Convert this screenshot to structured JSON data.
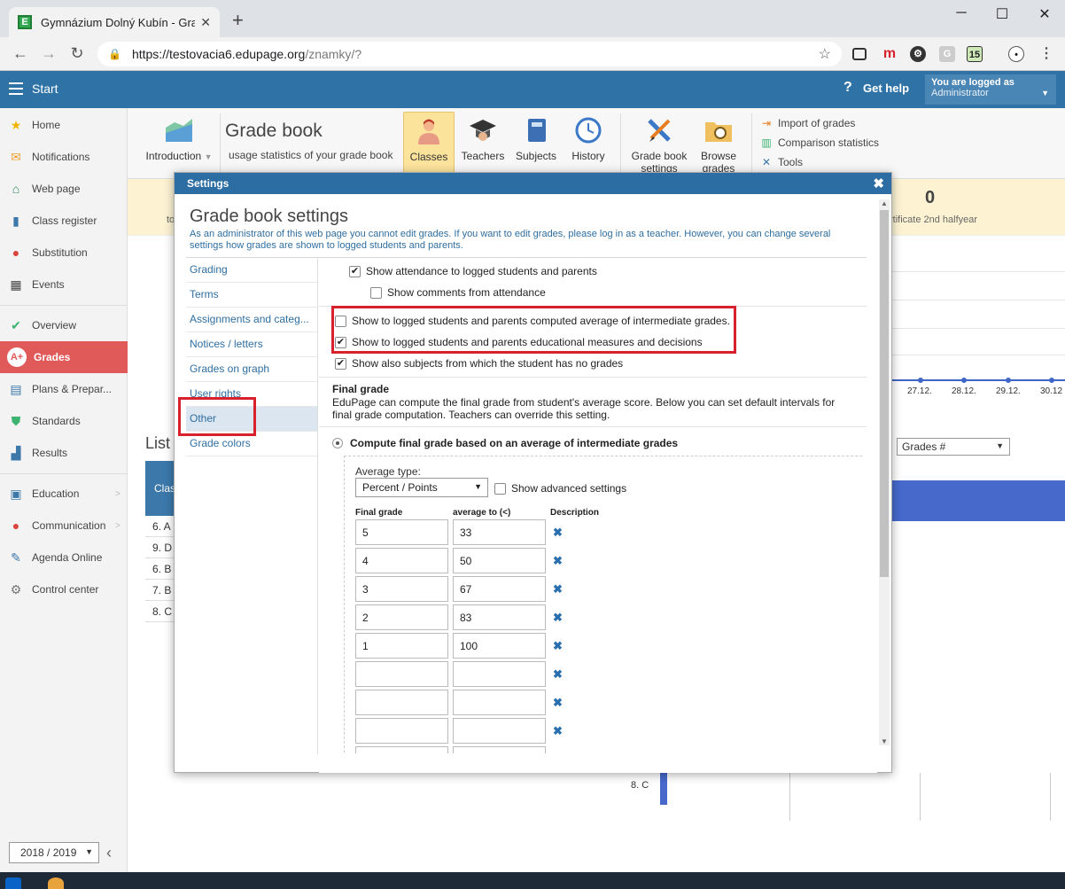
{
  "browser": {
    "tab_title": "Gymnázium Dolný Kubín - Grade",
    "url_host": "https://testovacia6.edupage.org",
    "url_path": "/znamky/?",
    "extensions": [
      "m",
      "G",
      "15"
    ]
  },
  "header": {
    "start": "Start",
    "help": "Get help",
    "logged_as": "You are logged as",
    "user": "Administrator"
  },
  "sidebar": {
    "items": [
      {
        "label": "Home",
        "icon": "star-icon"
      },
      {
        "label": "Notifications",
        "icon": "envelope-icon"
      },
      {
        "label": "Web page",
        "icon": "house-icon"
      },
      {
        "label": "Class register",
        "icon": "book-icon"
      },
      {
        "label": "Substitution",
        "icon": "person-icon"
      },
      {
        "label": "Events",
        "icon": "calendar-icon"
      },
      {
        "label": "Overview",
        "icon": "check-icon"
      },
      {
        "label": "Grades",
        "icon": "grade-icon"
      },
      {
        "label": "Plans & Prepar...",
        "icon": "briefcase-icon"
      },
      {
        "label": "Standards",
        "icon": "shield-icon"
      },
      {
        "label": "Results",
        "icon": "barchart-icon"
      },
      {
        "label": "Education",
        "icon": "education-icon"
      },
      {
        "label": "Communication",
        "icon": "chat-icon"
      },
      {
        "label": "Agenda Online",
        "icon": "pen-icon"
      },
      {
        "label": "Control center",
        "icon": "gear-icon"
      }
    ],
    "year": "2018 / 2019"
  },
  "ribbon": {
    "introduction": "Introduction",
    "title": "Grade book",
    "subtitle": "usage statistics of your grade book",
    "classes": "Classes",
    "teachers": "Teachers",
    "subjects": "Subjects",
    "history": "History",
    "settings_l1": "Grade book",
    "settings_l2": "settings",
    "browse_l1": "Browse",
    "browse_l2": "grades",
    "import": "Import of grades",
    "comparison": "Comparison statistics",
    "tools": "Tools"
  },
  "background": {
    "stat_value": "0",
    "stat_label": "rtificate 2nd halfyear",
    "stat_left": "to",
    "dates": [
      "27.12.",
      "28.12.",
      "29.12.",
      "30.12"
    ],
    "list_title": "List",
    "grades_select": "Grades #",
    "class_head": "Clas",
    "class_rows": [
      "6. A",
      "9. D",
      "6. B",
      "7. B",
      "8. C"
    ],
    "bar_label": "8. C"
  },
  "dialog": {
    "header": "Settings",
    "title": "Grade book settings",
    "description": "As an administrator of this web page you cannot edit grades. If you want to edit grades, please log in as a teacher. However, you can change several settings how grades are shown to logged students and parents.",
    "nav": [
      "Grading",
      "Terms",
      "Assignments and categ...",
      "Notices / letters",
      "Grades on graph",
      "User rights",
      "Other",
      "Grade colors"
    ],
    "options": {
      "attendance": {
        "label": "Show attendance to logged students and parents",
        "checked": true
      },
      "comments": {
        "label": "Show comments from attendance",
        "checked": false
      },
      "average": {
        "label": "Show to logged students and parents computed average of intermediate grades.",
        "checked": false
      },
      "measures": {
        "label": "Show to logged students and parents educational measures and decisions",
        "checked": true
      },
      "no_grades": {
        "label": "Show also subjects from which the student has no grades",
        "checked": true
      }
    },
    "final_grade_title": "Final grade",
    "final_grade_desc": "EduPage can compute the final grade from student's average score. Below you can set default intervals for final grade computation. Teachers can override this setting.",
    "compute_label": "Compute final grade based on an average of intermediate grades",
    "avg_type_label": "Average type:",
    "avg_type_value": "Percent / Points",
    "advanced_label": "Show advanced settings",
    "col_final": "Final grade",
    "col_avg": "average to (<)",
    "col_desc": "Description",
    "rows": [
      {
        "grade": "5",
        "avg": "33"
      },
      {
        "grade": "4",
        "avg": "50"
      },
      {
        "grade": "3",
        "avg": "67"
      },
      {
        "grade": "2",
        "avg": "83"
      },
      {
        "grade": "1",
        "avg": "100"
      },
      {
        "grade": "",
        "avg": ""
      },
      {
        "grade": "",
        "avg": ""
      },
      {
        "grade": "",
        "avg": ""
      }
    ]
  }
}
